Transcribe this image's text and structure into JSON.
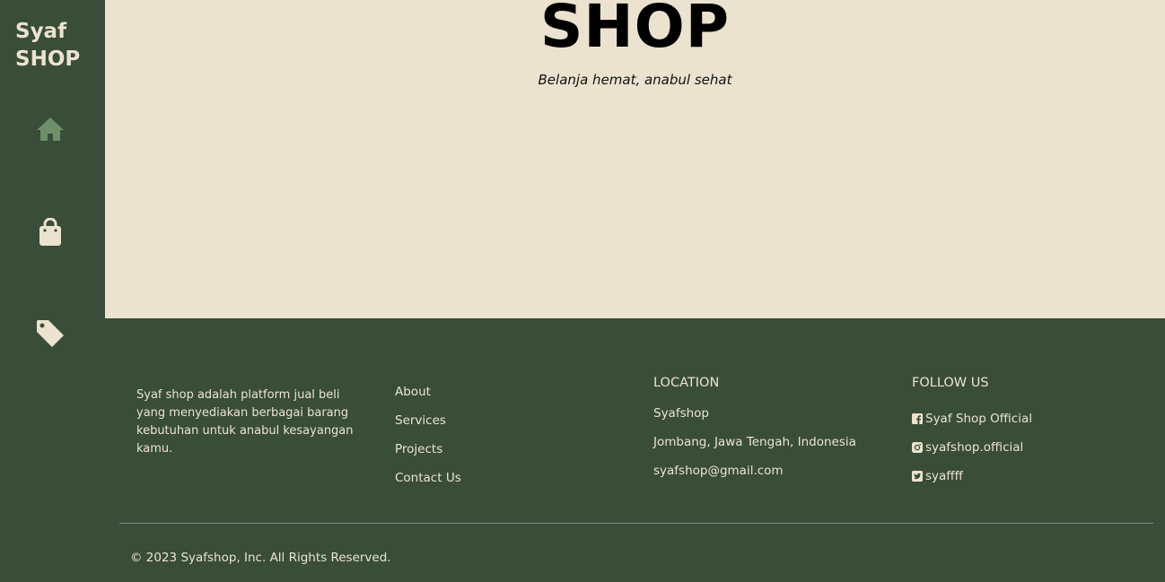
{
  "sidebar": {
    "brand_line1": "Syaf",
    "brand_line2": "SHOP",
    "nav": [
      {
        "icon": "home-icon",
        "active_color": "#6e8f6a"
      },
      {
        "icon": "shopping-bag-icon"
      },
      {
        "icon": "tag-icon"
      }
    ]
  },
  "hero": {
    "title": "SHOP",
    "subtitle": "Belanja hemat, anabul sehat"
  },
  "footer": {
    "about": "Syaf shop adalah platform jual beli yang menyediakan berbagai barang kebutuhan untuk anabul kesayangan kamu.",
    "links": [
      "About",
      "Services",
      "Projects",
      "Contact Us"
    ],
    "location": {
      "title": "LOCATION",
      "name": "Syafshop",
      "address": "Jombang, Jawa Tengah, Indonesia",
      "email": "syafshop@gmail.com"
    },
    "follow": {
      "title": "FOLLOW US",
      "facebook": "Syaf Shop Official",
      "instagram": "syafshop.official",
      "twitter": "syaffff"
    },
    "copyright": "© 2023 Syafshop, Inc. All Rights Reserved."
  },
  "colors": {
    "dark_green": "#394d38",
    "cream": "#ebe3cf",
    "accent_green": "#6e8f6a"
  }
}
